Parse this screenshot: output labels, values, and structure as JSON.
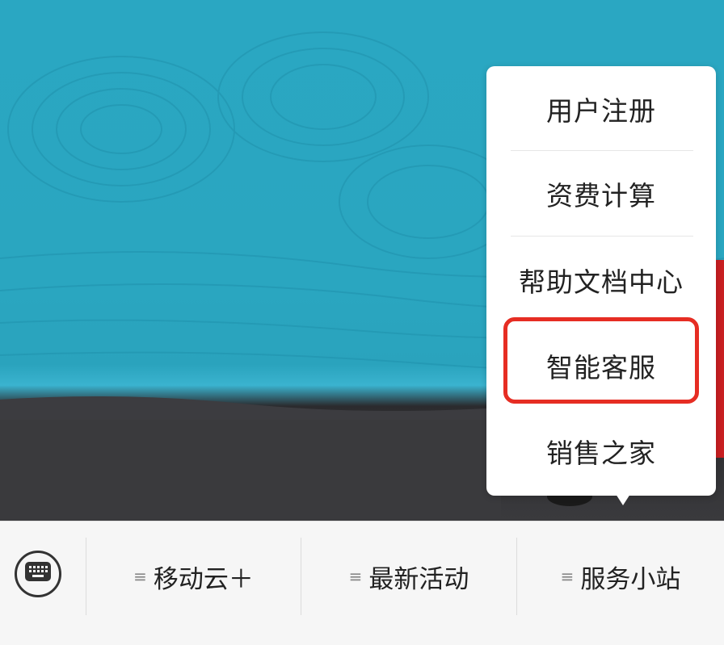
{
  "popup_menu": {
    "items": [
      {
        "label": "用户注册"
      },
      {
        "label": "资费计算"
      },
      {
        "label": "帮助文档中心"
      },
      {
        "label": "智能客服",
        "highlighted": true
      },
      {
        "label": "销售之家"
      }
    ],
    "highlight_color": "#e62d23"
  },
  "tabbar": {
    "keyboard_icon": "keyboard-icon",
    "tabs": [
      {
        "label": "移动云＋",
        "icon": "menu-lines-icon"
      },
      {
        "label": "最新活动",
        "icon": "menu-lines-icon"
      },
      {
        "label": "服务小站",
        "icon": "menu-lines-icon"
      }
    ],
    "menu_mark": "≡"
  },
  "colors": {
    "banner_sky": "#2aa7c2",
    "banner_ground": "#333336",
    "banner_red": "#c81f21",
    "tabbar_bg": "#f6f6f6"
  }
}
